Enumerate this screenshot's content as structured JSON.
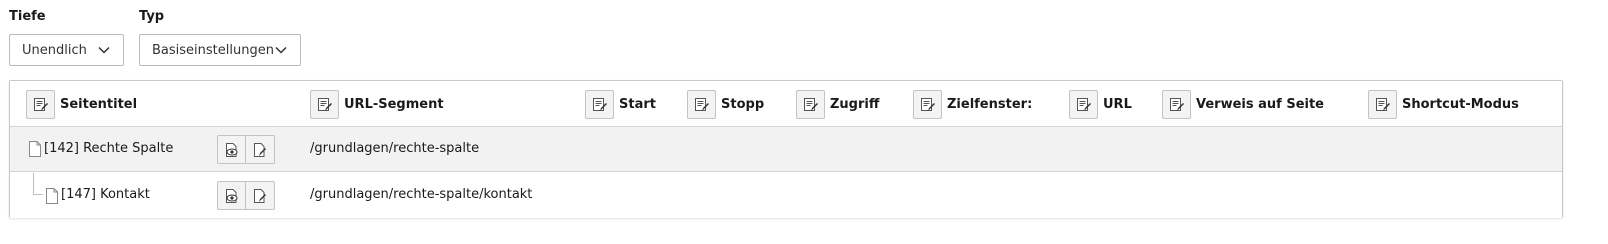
{
  "filters": {
    "depth": {
      "label": "Tiefe",
      "value": "Unendlich"
    },
    "type": {
      "label": "Typ",
      "value": "Basiseinstellungen"
    }
  },
  "columns": [
    {
      "label": "Seitentitel"
    },
    {
      "label": "URL-Segment"
    },
    {
      "label": "Start"
    },
    {
      "label": "Stopp"
    },
    {
      "label": "Zugriff"
    },
    {
      "label": "Zielfenster:"
    },
    {
      "label": "URL"
    },
    {
      "label": "Verweis auf Seite"
    },
    {
      "label": "Shortcut-Modus"
    }
  ],
  "rows": [
    {
      "title": "[142] Rechte Spalte",
      "url_segment": "/grundlagen/rechte-spalte"
    },
    {
      "title": "[147] Kontakt",
      "url_segment": "/grundlagen/rechte-spalte/kontakt"
    }
  ],
  "icons": {
    "column_edit": "edit-multiple-icon",
    "page": "page-icon",
    "view": "view-page-icon",
    "edit": "edit-page-icon",
    "dropdown": "chevron-down-icon"
  }
}
